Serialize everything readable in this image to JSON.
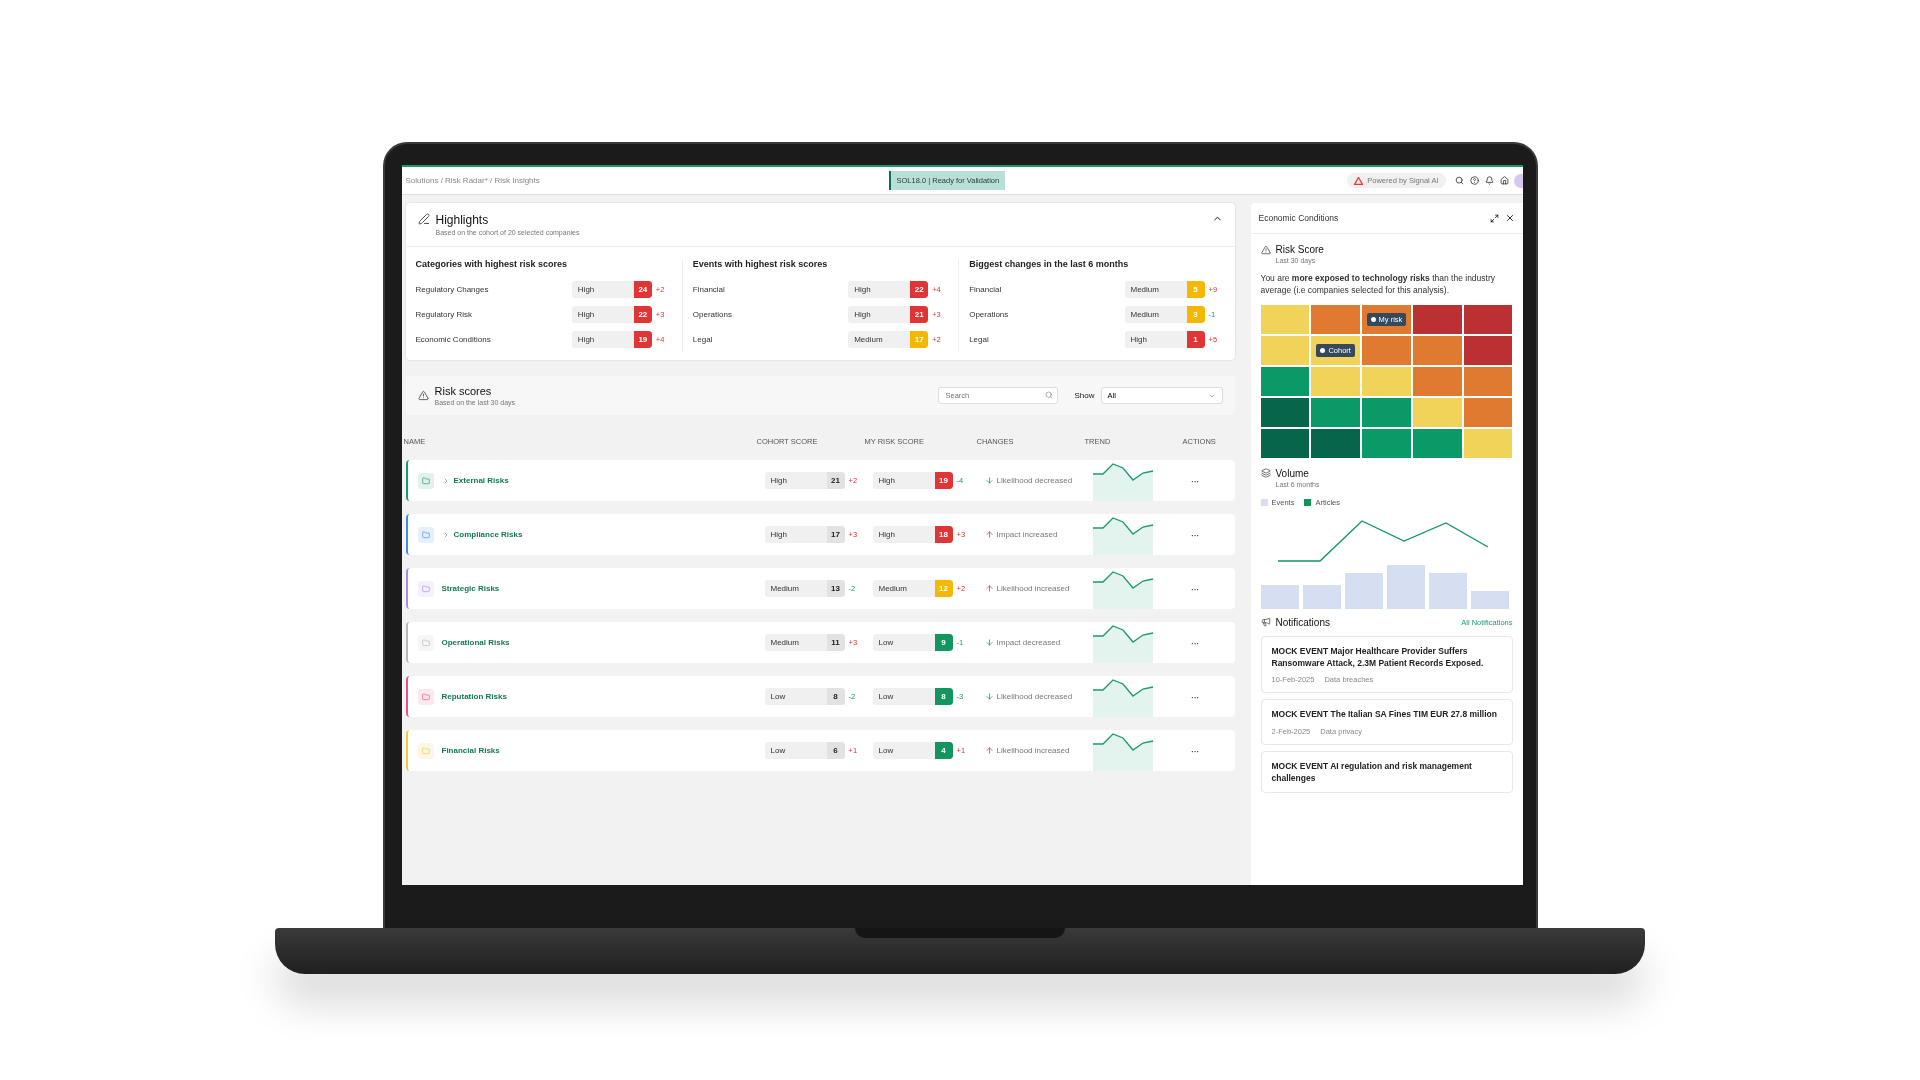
{
  "topbar": {
    "breadcrumb": "Solutions / Risk Radar* / Risk Insights",
    "status_badge": "SOL18.0 | Ready for Validation",
    "powered_by": "Powered by Signal AI"
  },
  "highlights": {
    "title": "Highlights",
    "subtitle": "Based on the cohort of 20 selected companies",
    "expanded": true,
    "columns": [
      {
        "title": "Categories with highest risk scores",
        "items": [
          {
            "label": "Regulatory Changes",
            "rating": "High",
            "score": "24",
            "color": "#e03535",
            "delta": "+2",
            "rising": true
          },
          {
            "label": "Regulatory Risk",
            "rating": "High",
            "score": "22",
            "color": "#e03535",
            "delta": "+3",
            "rising": true
          },
          {
            "label": "Economic Conditions",
            "rating": "High",
            "score": "19",
            "color": "#e03535",
            "delta": "+4",
            "rising": true
          }
        ]
      },
      {
        "title": "Events with highest risk scores",
        "items": [
          {
            "label": "Financial",
            "rating": "High",
            "score": "22",
            "color": "#e03535",
            "delta": "+4",
            "rising": true
          },
          {
            "label": "Operations",
            "rating": "High",
            "score": "21",
            "color": "#e03535",
            "delta": "+3",
            "rising": true
          },
          {
            "label": "Legal",
            "rating": "Medium",
            "score": "17",
            "color": "#f5b800",
            "delta": "+2",
            "rising": true
          }
        ]
      },
      {
        "title": "Biggest changes in the last 6 months",
        "items": [
          {
            "label": "Financial",
            "rating": "Medium",
            "score": "5",
            "color": "#f5b800",
            "delta": "+9",
            "rising": true
          },
          {
            "label": "Operations",
            "rating": "Medium",
            "score": "3",
            "color": "#f5b800",
            "delta": "-1",
            "rising": false
          },
          {
            "label": "Legal",
            "rating": "High",
            "score": "1",
            "color": "#e03535",
            "delta": "+5",
            "rising": true
          }
        ]
      }
    ]
  },
  "risk_scores": {
    "title": "Risk scores",
    "subtitle": "Based on the last 30 days",
    "search": {
      "placeholder": "Search"
    },
    "show_label": "Show",
    "show_value": "All",
    "columns": [
      "NAME",
      "COHORT SCORE",
      "MY RISK SCORE",
      "CHANGES",
      "TREND",
      "ACTIONS"
    ],
    "rows": [
      {
        "name": "External Risks",
        "color": "#1a9a6c",
        "expandable": true,
        "cohort": {
          "rating": "High",
          "score": "21",
          "delta": "+2",
          "rising": true
        },
        "mine": {
          "rating": "High",
          "score": "19",
          "color": "#e03535",
          "delta": "-4",
          "rising": false
        },
        "change": {
          "text": "Likelihood decreased",
          "rising": false
        },
        "actions": "···"
      },
      {
        "name": "Compliance Risks",
        "color": "#3b8ee8",
        "expandable": true,
        "cohort": {
          "rating": "High",
          "score": "17",
          "delta": "+3",
          "rising": true
        },
        "mine": {
          "rating": "High",
          "score": "18",
          "color": "#e03535",
          "delta": "+3",
          "rising": true
        },
        "change": {
          "text": "Impact increased",
          "rising": true
        },
        "actions": "···"
      },
      {
        "name": "Strategic Risks",
        "color": "#a98be8",
        "expandable": false,
        "cohort": {
          "rating": "Medium",
          "score": "13",
          "delta": "-2",
          "rising": false
        },
        "mine": {
          "rating": "Medium",
          "score": "12",
          "color": "#f5b800",
          "delta": "+2",
          "rising": true
        },
        "change": {
          "text": "Likelihood increased",
          "rising": true
        },
        "actions": "···"
      },
      {
        "name": "Operational Risks",
        "color": "#b8b8b8",
        "expandable": false,
        "cohort": {
          "rating": "Medium",
          "score": "11",
          "delta": "+3",
          "rising": true
        },
        "mine": {
          "rating": "Low",
          "score": "9",
          "color": "#12955f",
          "delta": "-1",
          "rising": false
        },
        "change": {
          "text": "Impact decreased",
          "rising": false
        },
        "actions": "···"
      },
      {
        "name": "Reputation Risks",
        "color": "#e8508a",
        "expandable": false,
        "cohort": {
          "rating": "Low",
          "score": "8",
          "delta": "-2",
          "rising": false
        },
        "mine": {
          "rating": "Low",
          "score": "8",
          "color": "#12955f",
          "delta": "-3",
          "rising": false
        },
        "change": {
          "text": "Likelihood decreased",
          "rising": false
        },
        "actions": "···"
      },
      {
        "name": "Financial Risks",
        "color": "#f0c93a",
        "expandable": false,
        "cohort": {
          "rating": "Low",
          "score": "6",
          "delta": "+1",
          "rising": true
        },
        "mine": {
          "rating": "Low",
          "score": "4",
          "color": "#12955f",
          "delta": "+1",
          "rising": true
        },
        "change": {
          "text": "Likelihood increased",
          "rising": true
        },
        "actions": "···"
      }
    ]
  },
  "side_panel": {
    "title": "Economic Conditions",
    "risk_score": {
      "title": "Risk Score",
      "subtitle": "Last 30 days",
      "text": "You are **more exposed to technology risks** than the industry average (i.e companies selected for this analysis).",
      "heatmap": [
        [
          {
            "color": "#f2d35a"
          },
          {
            "color": "#e07a30"
          },
          {
            "color": "#e07a30",
            "marker": "My risk"
          },
          {
            "color": "#bb3030"
          },
          {
            "color": "#bb3030"
          }
        ],
        [
          {
            "color": "#f2d35a"
          },
          {
            "color": "#f2d35a",
            "marker": "Cohort"
          },
          {
            "color": "#e07a30"
          },
          {
            "color": "#e07a30"
          },
          {
            "color": "#bb3030"
          }
        ],
        [
          {
            "color": "#0a9a68"
          },
          {
            "color": "#f2d35a"
          },
          {
            "color": "#f2d35a"
          },
          {
            "color": "#e07a30"
          },
          {
            "color": "#e07a30"
          }
        ],
        [
          {
            "color": "#06654a"
          },
          {
            "color": "#0a9a68"
          },
          {
            "color": "#0a9a68"
          },
          {
            "color": "#f2d35a"
          },
          {
            "color": "#e07a30"
          }
        ],
        [
          {
            "color": "#06654a"
          },
          {
            "color": "#06654a"
          },
          {
            "color": "#0a9a68"
          },
          {
            "color": "#0a9a68"
          },
          {
            "color": "#f2d35a"
          }
        ]
      ]
    },
    "volume": {
      "title": "Volume",
      "subtitle": "Last 6 months",
      "legend": [
        "Events",
        "Articles"
      ]
    },
    "notifications": {
      "title": "Notifications",
      "link": "All Notifications",
      "items": [
        {
          "title": "MOCK EVENT Major Healthcare Provider Suffers Ransomware Attack, 2.3M Patient Records Exposed.",
          "date": "10-Feb-2025",
          "tag": "Data breaches"
        },
        {
          "title": "MOCK EVENT The Italian SA Fines TIM EUR 27.8 million",
          "date": "2-Feb-2025",
          "tag": "Data privacy"
        },
        {
          "title": "MOCK EVENT AI regulation and risk management challenges"
        }
      ]
    }
  }
}
